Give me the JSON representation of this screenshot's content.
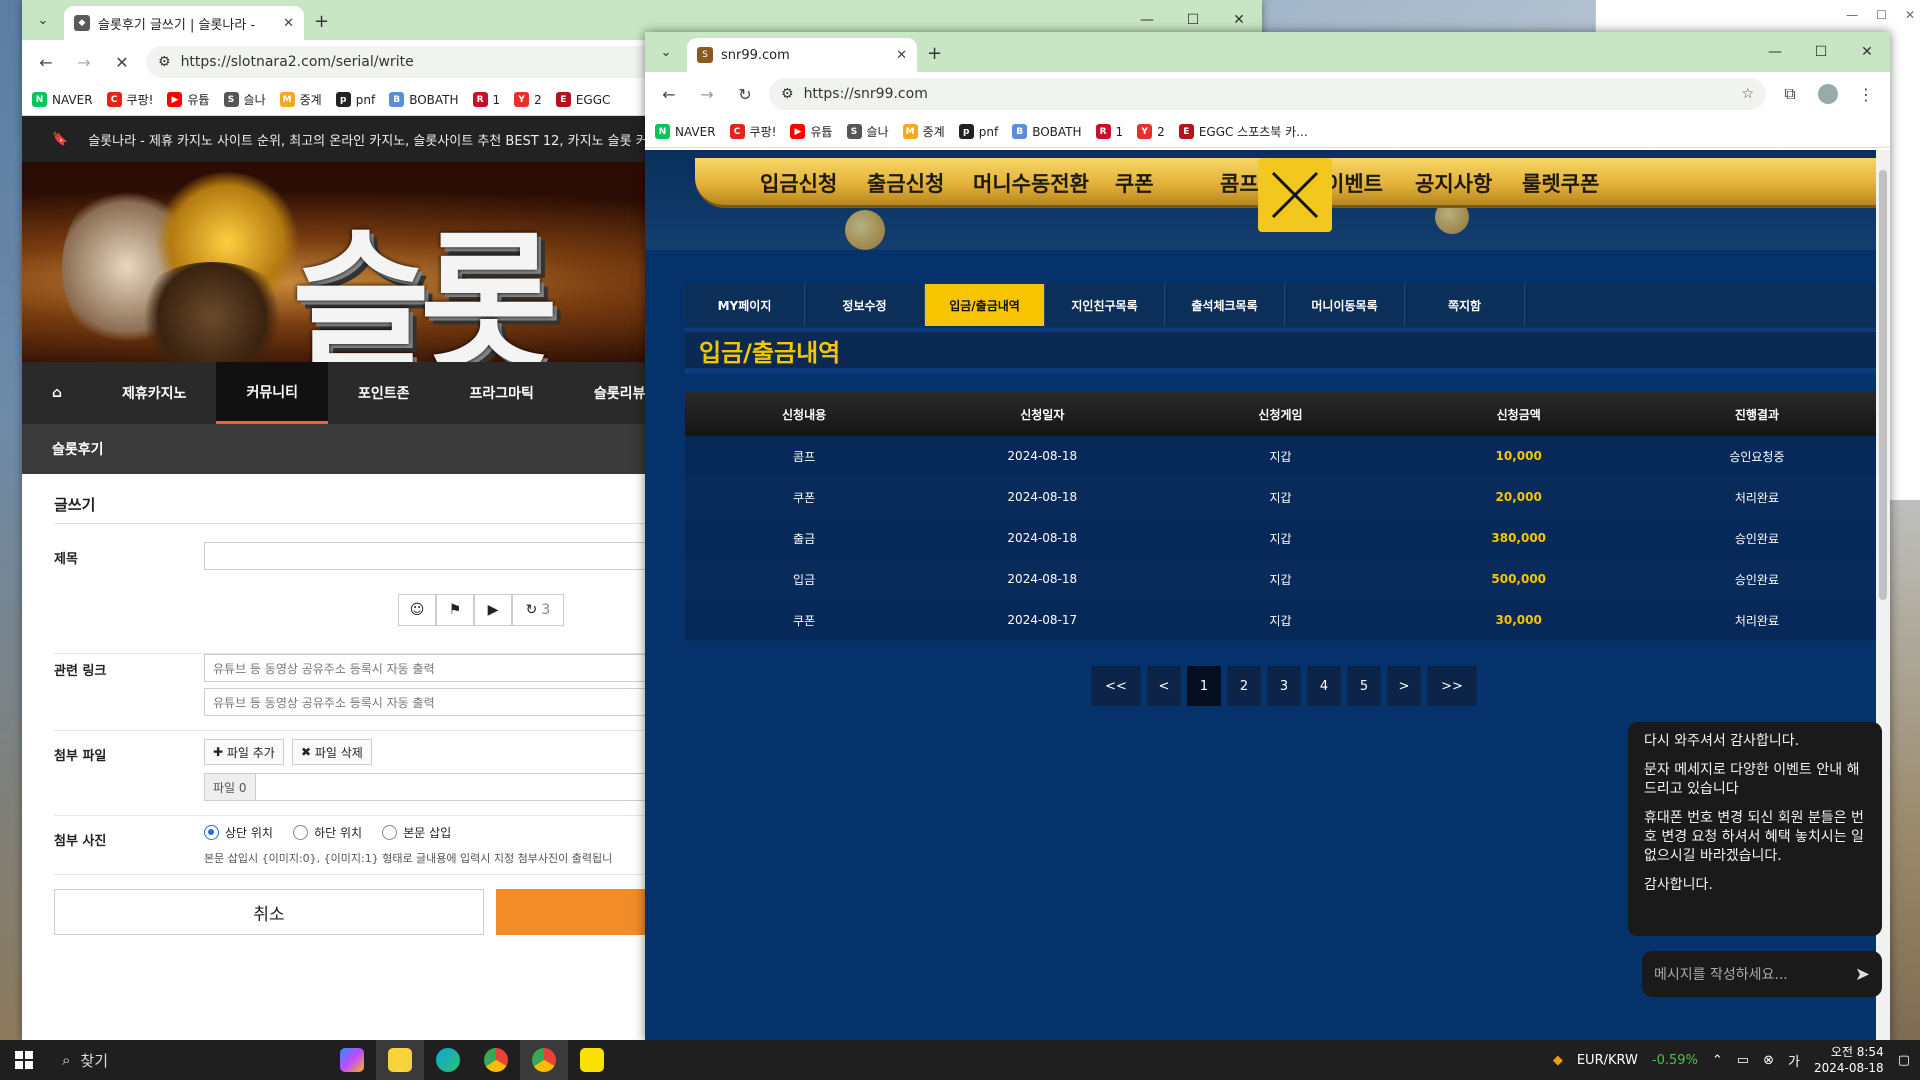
{
  "left_browser": {
    "tab_title": "슬롯후기 글쓰기 | 슬롯나라 - ",
    "url": "https://slotnara2.com/serial/write",
    "bookmarks": [
      {
        "label": "NAVER",
        "color": "#03c75a",
        "glyph": "N"
      },
      {
        "label": "쿠팡!",
        "color": "#e1251b",
        "glyph": "C"
      },
      {
        "label": "유튭",
        "color": "#ff0000",
        "glyph": "▶"
      },
      {
        "label": "슬나",
        "color": "#555555",
        "glyph": "S"
      },
      {
        "label": "중계",
        "color": "#f5a623",
        "glyph": "M"
      },
      {
        "label": "pnf",
        "color": "#222222",
        "glyph": "p"
      },
      {
        "label": "BOBATH",
        "color": "#5c8dd6",
        "glyph": "B"
      },
      {
        "label": "1",
        "color": "#c8102e",
        "glyph": "R"
      },
      {
        "label": "2",
        "color": "#e8302a",
        "glyph": "Y"
      },
      {
        "label": "EGGC",
        "color": "#b5121b",
        "glyph": "E"
      }
    ],
    "site": {
      "topbar_text": "슬롯나라 - 제휴 카지노 사이트 순위, 최고의 온라인 카지노, 슬롯사이트 추천 BEST 12, 카지노 슬롯 커뮤니티",
      "banner_text": "슬롯",
      "nav": [
        "제휴카지노",
        "커뮤니티",
        "포인트존",
        "프라그마틱",
        "슬롯리뷰"
      ],
      "nav_active": "커뮤니티",
      "sub_title": "슬롯후기",
      "form_title": "글쓰기",
      "label_subject": "제목",
      "editor_counter": "3",
      "label_links": "관련 링크",
      "link_placeholder_1": "유튜브 등 동영상 공유주소 등록시 자동 출력",
      "link_placeholder_2": "유튜브 등 동영상 공유주소 등록시 자동 출력",
      "label_files": "첨부 파일",
      "btn_add_file": "파일 추가",
      "btn_del_file": "파일 삭제",
      "file_count": "파일 0",
      "label_photo": "첨부 사진",
      "radio_top": "상단 위치",
      "radio_bottom": "하단 위치",
      "radio_inline": "본문 삽입",
      "photo_hint": "본문 삽입시 {이미지:0}, {이미지:1} 형태로 글내용에 입력시 지정 첨부사진이 출력됩니",
      "btn_cancel": "취소"
    }
  },
  "right_browser": {
    "tab_title": "snr99.com",
    "url": "https://snr99.com",
    "bookmarks": [
      {
        "label": "NAVER",
        "color": "#03c75a",
        "glyph": "N"
      },
      {
        "label": "쿠팡!",
        "color": "#e1251b",
        "glyph": "C"
      },
      {
        "label": "유튭",
        "color": "#ff0000",
        "glyph": "▶"
      },
      {
        "label": "슬나",
        "color": "#555555",
        "glyph": "S"
      },
      {
        "label": "중계",
        "color": "#f5a623",
        "glyph": "M"
      },
      {
        "label": "pnf",
        "color": "#222222",
        "glyph": "p"
      },
      {
        "label": "BOBATH",
        "color": "#5c8dd6",
        "glyph": "B"
      },
      {
        "label": "1",
        "color": "#c8102e",
        "glyph": "R"
      },
      {
        "label": "2",
        "color": "#e8302a",
        "glyph": "Y"
      },
      {
        "label": "EGGC 스포츠북 카...",
        "color": "#b5121b",
        "glyph": "E"
      }
    ],
    "top_menu": [
      "입금신청",
      "출금신청",
      "머니수동전환",
      "쿠폰",
      "콤프신청",
      "이벤트",
      "공지사항",
      "룰렛쿠폰"
    ],
    "tabs": [
      "MY페이지",
      "정보수정",
      "입금/출금내역",
      "지인친구목록",
      "출석체크목록",
      "머니이동목록",
      "쪽지함"
    ],
    "active_tab": "입금/출금내역",
    "section_title": "입금/출금내역",
    "table": {
      "columns": [
        "신청내용",
        "신청일자",
        "신청게임",
        "신청금액",
        "진행결과"
      ],
      "rows": [
        [
          "콤프",
          "2024-08-18",
          "지갑",
          "10,000",
          "승인요청중"
        ],
        [
          "쿠폰",
          "2024-08-18",
          "지갑",
          "20,000",
          "처리완료"
        ],
        [
          "출금",
          "2024-08-18",
          "지갑",
          "380,000",
          "승인완료"
        ],
        [
          "입금",
          "2024-08-18",
          "지갑",
          "500,000",
          "승인완료"
        ],
        [
          "쿠폰",
          "2024-08-17",
          "지갑",
          "30,000",
          "처리완료"
        ]
      ]
    },
    "pager": {
      "first": "<<",
      "prev": "<",
      "pages": [
        "1",
        "2",
        "3",
        "4",
        "5"
      ],
      "current": "1",
      "next": ">",
      "last": ">>"
    },
    "chat": {
      "lines": [
        "다시 와주셔서 감사합니다.",
        "문자 메세지로 다양한 이벤트 안내 해드리고 있습니다",
        "휴대폰 번호 변경 되신 회원 분들은 번호 변경 요청 하셔서 혜택 놓치시는 일 없으시길 바라겠습니다.",
        "감사합니다."
      ],
      "input_placeholder": "메시지를 작성하세요..."
    }
  },
  "taskbar": {
    "search_label": "찾기",
    "currency_pair": "EUR/KRW",
    "currency_change": "-0.59%",
    "time": "오전 8:54",
    "date": "2024-08-18",
    "colors": {
      "change": "#4cc24c"
    }
  }
}
